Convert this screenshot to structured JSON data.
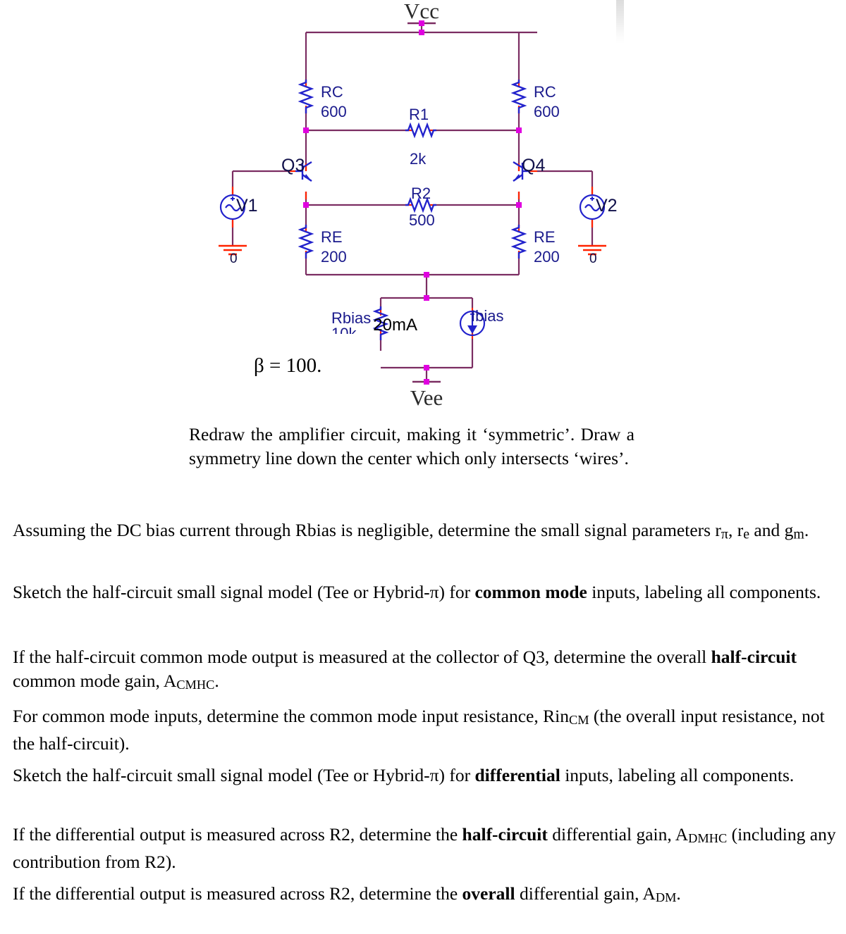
{
  "schematic": {
    "title_nodes": {
      "vcc": "Vcc",
      "vee": "Vee"
    },
    "components": [
      {
        "id": "RC_left",
        "name": "RC",
        "value": "600"
      },
      {
        "id": "RC_right",
        "name": "RC",
        "value": "600"
      },
      {
        "id": "R1",
        "name": "R1",
        "value": "2k"
      },
      {
        "id": "R2",
        "name": "R2",
        "value": "500"
      },
      {
        "id": "RE_left",
        "name": "RE",
        "value": "200"
      },
      {
        "id": "RE_right",
        "name": "RE",
        "value": "200"
      },
      {
        "id": "Rbias",
        "name": "Rbias",
        "value": ""
      },
      {
        "id": "Ibias",
        "name": "Ibias",
        "value": "20mA"
      },
      {
        "id": "Q3",
        "name": "Q3",
        "value": ""
      },
      {
        "id": "Q4",
        "name": "Q4",
        "value": ""
      },
      {
        "id": "V1",
        "name": "V1",
        "value": ""
      },
      {
        "id": "V2",
        "name": "V2",
        "value": ""
      }
    ],
    "labels": {
      "rc_left_name": "RC",
      "rc_left_value": "600",
      "rc_right_name": "RC",
      "rc_right_value": "600",
      "r1_name": "R1",
      "r1_value": "2k",
      "r2_name": "R2",
      "r2_value": "500",
      "re_left_name": "RE",
      "re_left_value": "200",
      "re_right_name": "RE",
      "re_right_value": "200",
      "rbias_name": "Rbias",
      "ibias_name": "Ibias",
      "ibias_value": "20mA",
      "q3": "Q3",
      "q4": "Q4",
      "v1": "V1",
      "v2": "V2",
      "gnd_left": "0",
      "gnd_right": "0",
      "vcc": "Vcc",
      "vee": "Vee"
    },
    "colors": {
      "wire": "#7b2d62",
      "pin": "#ff2200",
      "node": "#e000e0",
      "symbol": "#2222cc",
      "text_blue": "#1a1a8c",
      "text_black": "#000000"
    }
  },
  "beta_note": "β = 100.",
  "questions": {
    "q_redraw": "Redraw the amplifier circuit, making it ‘symmetric’. Draw a symmetry line down the center which only intersects ‘wires’.",
    "q_params_1": "Assuming the DC bias current through Rbias is negligible, determine the small signal",
    "q_params_2_pre": "parameters r",
    "q_params_2_sub1": "π",
    "q_params_2_mid": ", r",
    "q_params_2_sub2": "e",
    "q_params_2_mid2": " and g",
    "q_params_2_sub3": "m",
    "q_params_2_end": ".",
    "q_cm_sketch_a": "Sketch the half-circuit small signal model (Tee or Hybrid-π) for ",
    "q_cm_sketch_bold": "common mode",
    "q_cm_sketch_b": " inputs, labeling all components.",
    "q_acmhc_a": "If the half-circuit common mode output is measured at the collector of Q3, determine the overall ",
    "q_acmhc_bold": "half-circuit",
    "q_acmhc_b": " common mode gain, A",
    "q_acmhc_sub": "CMHC",
    "q_acmhc_c": ".",
    "q_rincm_a": "For common mode inputs, determine the common mode input resistance, Rin",
    "q_rincm_sub": "CM",
    "q_rincm_b": " (the overall input resistance, not the half-circuit).",
    "q_dm_sketch_a": "Sketch the half-circuit small signal model (Tee or Hybrid-π) for ",
    "q_dm_sketch_bold": "differential",
    "q_dm_sketch_b": " inputs, labeling all components.",
    "q_admhc_a": "If the differential output is measured across R2, determine the ",
    "q_admhc_bold": "half-circuit",
    "q_admhc_b": " differential gain, A",
    "q_admhc_sub": "DMHC",
    "q_admhc_c": " (including any contribution from R2).",
    "q_adm_a": "If the differential output is measured across R2, determine the ",
    "q_adm_bold": "overall",
    "q_adm_b": " differential gain, A",
    "q_adm_sub": "DM",
    "q_adm_c": "."
  }
}
